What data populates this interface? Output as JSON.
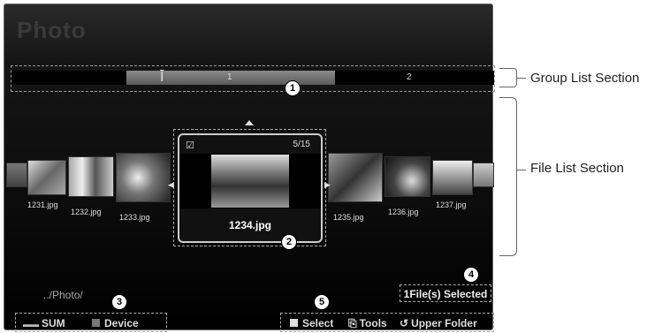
{
  "screen": {
    "title": "Photo",
    "group_list": {
      "segments": [
        "1",
        "2"
      ]
    },
    "files": [
      {
        "name": "1231.jpg"
      },
      {
        "name": "1232.jpg"
      },
      {
        "name": "1233.jpg"
      },
      {
        "name": "1234.jpg"
      },
      {
        "name": "1235.jpg"
      },
      {
        "name": "1236.jpg"
      },
      {
        "name": "1237.jpg"
      }
    ],
    "focused": {
      "name": "1234.jpg",
      "count": "5/15",
      "checkbox": "☑"
    },
    "path": "../Photo/",
    "selected": "1File(s) Selected",
    "bottom_left": {
      "sum": "SUM",
      "device": "Device"
    },
    "bottom_right": {
      "select": "Select",
      "tools": "Tools",
      "upper": "Upper Folder"
    }
  },
  "callouts": [
    "1",
    "2",
    "3",
    "4",
    "5"
  ],
  "labels": {
    "group": "Group List Section",
    "file": "File List Section"
  }
}
